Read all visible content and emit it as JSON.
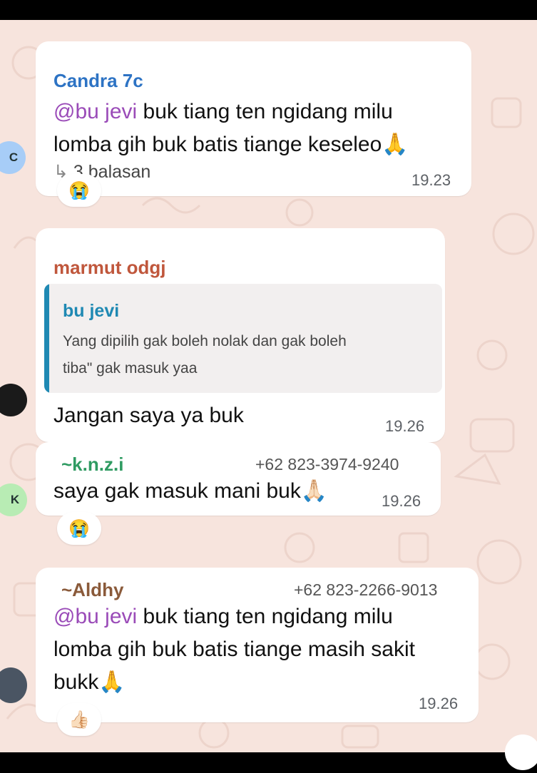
{
  "messages": [
    {
      "sender": "Candra 7c",
      "sender_color": "#2d73c4",
      "mention": "@bu jevi",
      "line1": " buk tiang ten ngidang milu",
      "line2": "lomba gih buk batis tiange keseleo",
      "replies": "3 balasan",
      "time": "19.23",
      "reaction": "😭",
      "avatar_letter": "C",
      "avatar_color": "#a7cdf7"
    },
    {
      "sender": "marmut odgj",
      "sender_color": "#c0573c",
      "quote_name": "bu jevi",
      "quote_line1": "Yang dipilih gak boleh nolak dan gak boleh",
      "quote_line2": "tiba\" gak masuk yaa",
      "text": "Jangan saya ya buk",
      "time": "19.26"
    },
    {
      "sender": "~k.n.z.i",
      "sender_color": "#2f9b62",
      "phone": "+62 823-3974-9240",
      "text": "saya gak masuk mani buk",
      "time": "19.26",
      "reaction": "😭",
      "avatar_letter": "K",
      "avatar_color": "#b8ecb4"
    },
    {
      "sender": "~Aldhy",
      "sender_color": "#8a5a3a",
      "phone": "+62 823-2266-9013",
      "mention": "@bu jevi",
      "line1": "  buk tiang ten ngidang milu",
      "line2": "lomba gih buk batis tiange masih sakit",
      "line3": "bukk",
      "time": "19.26",
      "reaction": "👍🏻"
    }
  ]
}
